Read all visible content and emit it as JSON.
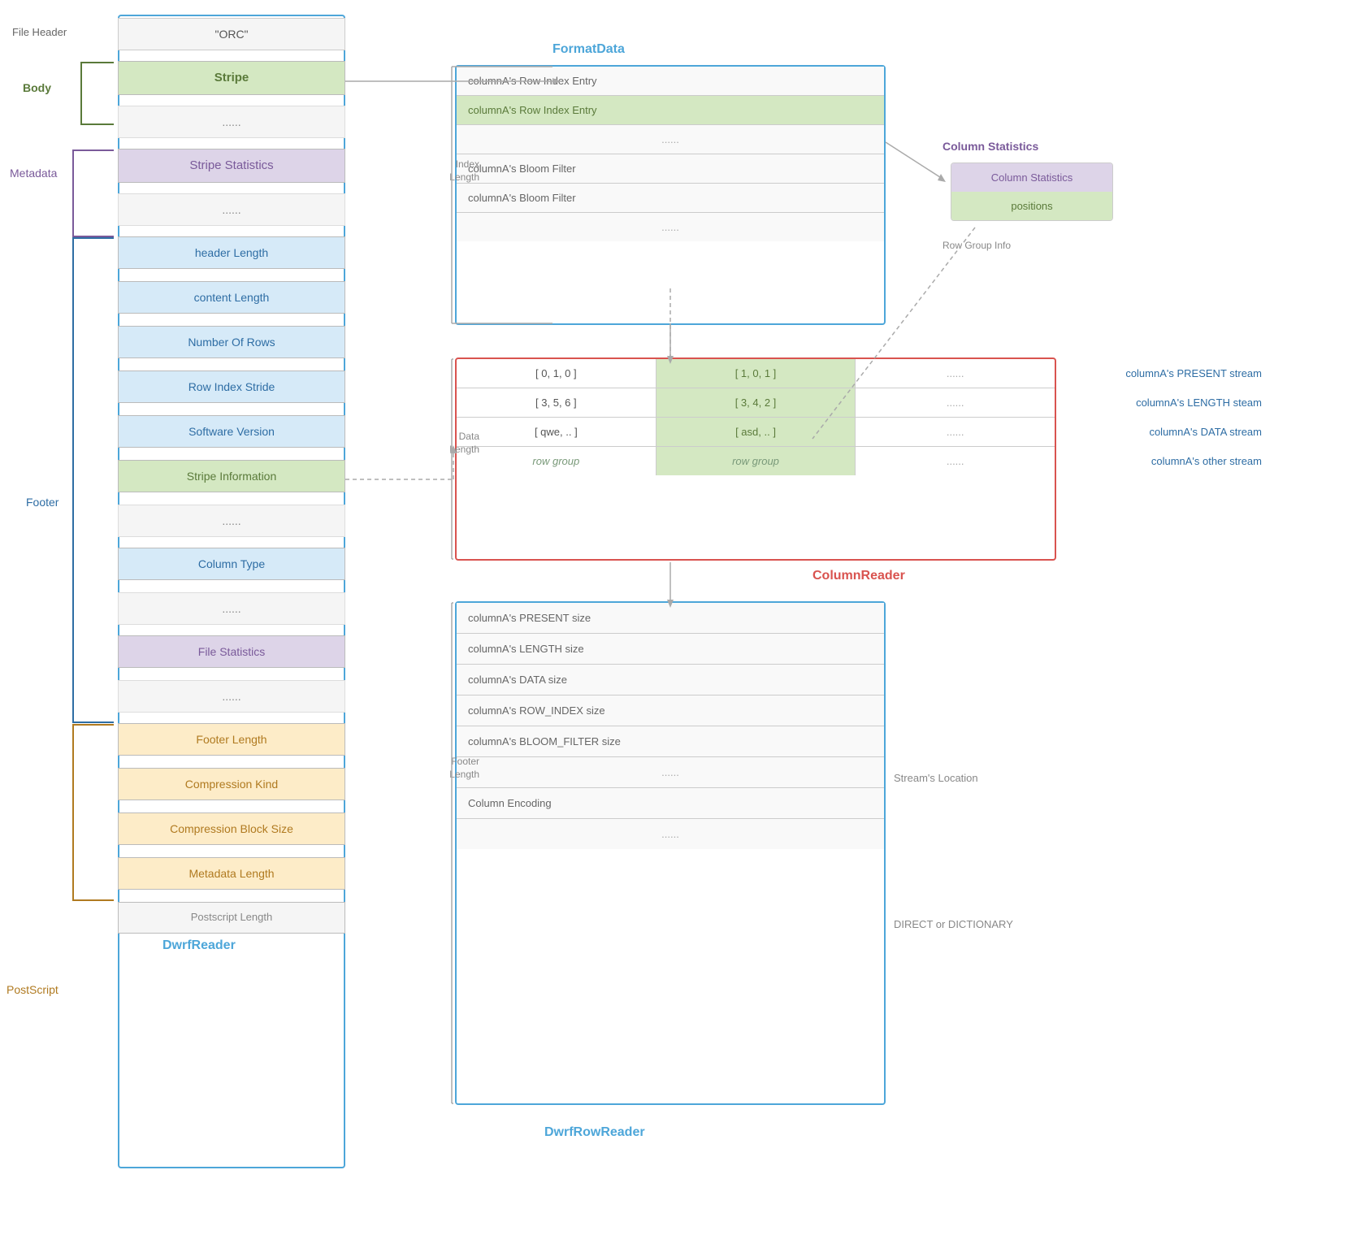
{
  "left_column": {
    "cells": [
      {
        "id": "file-header",
        "label": "\"ORC\"",
        "type": "file-header"
      },
      {
        "id": "stripe",
        "label": "Stripe",
        "type": "stripe"
      },
      {
        "id": "dots1",
        "label": "......",
        "type": "dots"
      },
      {
        "id": "stripe-stats",
        "label": "Stripe Statistics",
        "type": "stripe-stats"
      },
      {
        "id": "dots2",
        "label": "......",
        "type": "dots"
      },
      {
        "id": "header-length",
        "label": "header Length",
        "type": "footer-blue"
      },
      {
        "id": "content-length",
        "label": "content Length",
        "type": "footer-blue"
      },
      {
        "id": "number-of-rows",
        "label": "Number Of Rows",
        "type": "footer-blue"
      },
      {
        "id": "row-index-stride",
        "label": "Row Index Stride",
        "type": "footer-blue"
      },
      {
        "id": "software-version",
        "label": "Software Version",
        "type": "footer-blue"
      },
      {
        "id": "stripe-information",
        "label": "Stripe Information",
        "type": "footer-green"
      },
      {
        "id": "dots3",
        "label": "......",
        "type": "dots"
      },
      {
        "id": "column-type",
        "label": "Column Type",
        "type": "footer-blue"
      },
      {
        "id": "dots4",
        "label": "......",
        "type": "dots"
      },
      {
        "id": "file-statistics",
        "label": "File Statistics",
        "type": "file-stats"
      },
      {
        "id": "dots5",
        "label": "......",
        "type": "dots"
      },
      {
        "id": "footer-length",
        "label": "Footer Length",
        "type": "postscript"
      },
      {
        "id": "compression-kind",
        "label": "Compression Kind",
        "type": "postscript"
      },
      {
        "id": "compression-block-size",
        "label": "Compression Block Size",
        "type": "postscript"
      },
      {
        "id": "metadata-length",
        "label": "Metadata Length",
        "type": "postscript"
      },
      {
        "id": "postscript-length",
        "label": "Postscript Length",
        "type": "postscript-length"
      }
    ]
  },
  "labels": {
    "file_header": "File Header",
    "body": "Body",
    "metadata": "Metadata",
    "footer": "Footer",
    "postscript": "PostScript",
    "dwrf_reader": "DwrfReader",
    "format_data": "FormatData",
    "column_reader": "ColumnReader",
    "dwrf_row_reader": "DwrfRowReader",
    "row_group_info": "Row Group Info",
    "index_length": "Index\nLength",
    "data_length": "Data\nLength",
    "footer_length": "Footer\nLength",
    "streams_location": "Stream's Location",
    "direct_or_dictionary": "DIRECT or DICTIONARY"
  },
  "format_data": {
    "cells": [
      {
        "label": "columnA's Row Index Entry",
        "type": "normal"
      },
      {
        "label": "columnA's Row Index Entry",
        "type": "green"
      },
      {
        "label": "......",
        "type": "dots"
      },
      {
        "label": "columnA's Bloom Filter",
        "type": "normal"
      },
      {
        "label": "columnA's Bloom Filter",
        "type": "normal"
      },
      {
        "label": "......",
        "type": "dots"
      }
    ]
  },
  "column_statistics": {
    "label": "Column Statistics",
    "cells": [
      {
        "label": "Column Statistics",
        "type": "purple"
      },
      {
        "label": "positions",
        "type": "green"
      }
    ]
  },
  "column_reader": {
    "rows": [
      {
        "cells": [
          {
            "label": "[ 0, 1, 0 ]",
            "type": "normal"
          },
          {
            "label": "[ 1, 0, 1 ]",
            "type": "green"
          },
          {
            "label": "......",
            "type": "dots"
          }
        ],
        "side_label": "columnA's PRESENT stream"
      },
      {
        "cells": [
          {
            "label": "[ 3, 5, 6 ]",
            "type": "normal"
          },
          {
            "label": "[ 3, 4, 2 ]",
            "type": "green"
          },
          {
            "label": "......",
            "type": "dots"
          }
        ],
        "side_label": "columnA's LENGTH steam"
      },
      {
        "cells": [
          {
            "label": "[ qwe, .. ]",
            "type": "normal"
          },
          {
            "label": "[ asd, .. ]",
            "type": "green"
          },
          {
            "label": "......",
            "type": "dots"
          }
        ],
        "side_label": "columnA's DATA stream"
      },
      {
        "cells": [
          {
            "label": "row group",
            "type": "italic"
          },
          {
            "label": "row group",
            "type": "italic-green"
          },
          {
            "label": "......",
            "type": "dots"
          }
        ],
        "side_label": "columnA's other stream"
      }
    ]
  },
  "dwrf_row_reader": {
    "cells": [
      {
        "label": "columnA's PRESENT size"
      },
      {
        "label": "columnA's LENGTH size"
      },
      {
        "label": "columnA's DATA size"
      },
      {
        "label": "columnA's ROW_INDEX size"
      },
      {
        "label": "columnA's BLOOM_FILTER size"
      },
      {
        "label": "......"
      },
      {
        "label": "Column Encoding"
      },
      {
        "label": "......"
      }
    ]
  }
}
